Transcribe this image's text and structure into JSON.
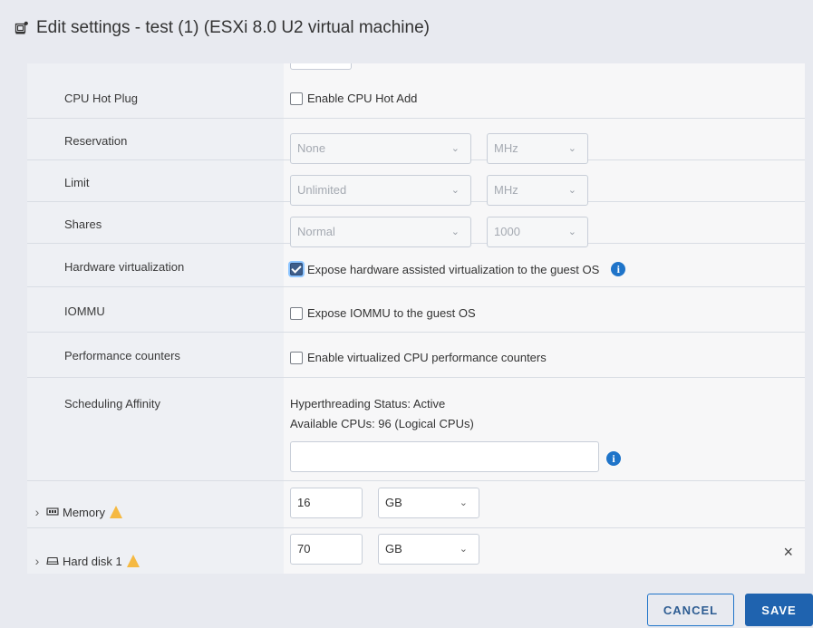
{
  "dialog": {
    "title": "Edit settings - test (1) (ESXi 8.0 U2 virtual machine)"
  },
  "rows": {
    "cpu_hot_plug": {
      "label": "CPU Hot Plug",
      "checkbox_label": "Enable CPU Hot Add",
      "checked": false
    },
    "reservation": {
      "label": "Reservation",
      "value": "None",
      "unit": "MHz"
    },
    "limit": {
      "label": "Limit",
      "value": "Unlimited",
      "unit": "MHz"
    },
    "shares": {
      "label": "Shares",
      "value": "Normal",
      "amount": "1000"
    },
    "hardware_virtualization": {
      "label": "Hardware virtualization",
      "checkbox_label": "Expose hardware assisted virtualization to the guest OS",
      "checked": true
    },
    "iommu": {
      "label": "IOMMU",
      "checkbox_label": "Expose IOMMU to the guest OS",
      "checked": false
    },
    "performance_counters": {
      "label": "Performance counters",
      "checkbox_label": "Enable virtualized CPU performance counters",
      "checked": false
    },
    "scheduling_affinity": {
      "label": "Scheduling Affinity",
      "status": "Hyperthreading Status: Active",
      "available": "Available CPUs: 96 (Logical CPUs)",
      "input_value": ""
    },
    "memory": {
      "label": "Memory",
      "value": "16",
      "unit": "GB"
    },
    "hard_disk": {
      "label": "Hard disk 1",
      "value": "70",
      "unit": "GB",
      "close_symbol": "×"
    }
  },
  "footer": {
    "cancel_label": "CANCEL",
    "save_label": "SAVE"
  },
  "colors": {
    "accent": "#1f74c9",
    "save_bg": "#1f63af",
    "checkbox_checked": "#3f5e8a",
    "warning": "#f5b942"
  },
  "icons": {
    "vm": "vm-icon",
    "info": "info-icon",
    "warning": "warning-icon",
    "memory": "memory-icon",
    "disk": "disk-icon",
    "chevron_right": "chevron-right-icon",
    "chevron_down": "chevron-down-icon",
    "close": "close-icon"
  }
}
